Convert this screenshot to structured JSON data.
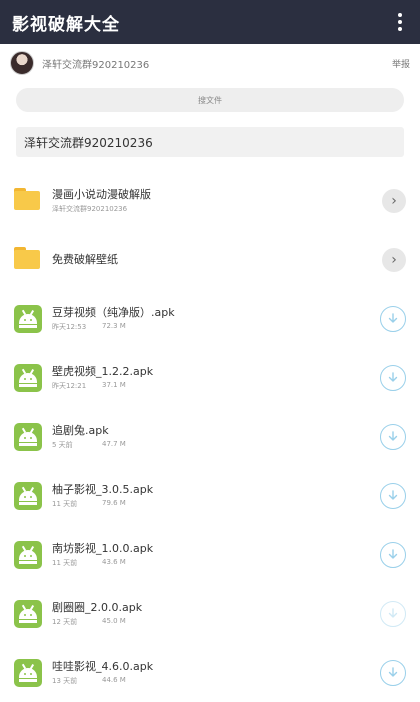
{
  "header": {
    "title": "影视破解大全"
  },
  "user": {
    "name": "泽轩交流群920210236",
    "report": "举报"
  },
  "search": {
    "label": "搜文件"
  },
  "notice": {
    "text": "泽轩交流群920210236"
  },
  "colors": {
    "appbar": "#2b2f40",
    "folder": "#f8c949",
    "apk": "#8bc34a",
    "download": "#9ad0ea"
  },
  "folders": [
    {
      "name": "漫画小说动漫破解版",
      "sub": "泽轩交流群920210236",
      "icon": "folder-icon",
      "action_icon": "chevron-right-icon"
    },
    {
      "name": "免费破解壁纸",
      "sub": "",
      "icon": "folder-icon",
      "action_icon": "chevron-right-icon"
    }
  ],
  "files": [
    {
      "name": "豆芽视频（纯净版）.apk",
      "time": "昨天12:53",
      "size": "72.3 M",
      "icon": "android-icon",
      "action_icon": "download-icon"
    },
    {
      "name": "壁虎视频_1.2.2.apk",
      "time": "昨天12:21",
      "size": "37.1 M",
      "icon": "android-icon",
      "action_icon": "download-icon"
    },
    {
      "name": "追剧兔.apk",
      "time": "5 天前",
      "size": "47.7 M",
      "icon": "android-icon",
      "action_icon": "download-icon"
    },
    {
      "name": "柚子影视_3.0.5.apk",
      "time": "11 天前",
      "size": "79.6 M",
      "icon": "android-icon",
      "action_icon": "download-icon"
    },
    {
      "name": "南坊影视_1.0.0.apk",
      "time": "11 天前",
      "size": "43.6 M",
      "icon": "android-icon",
      "action_icon": "download-icon"
    },
    {
      "name": "剧圈圈_2.0.0.apk",
      "time": "12 天前",
      "size": "45.0 M",
      "icon": "android-icon",
      "action_icon": "download-icon"
    },
    {
      "name": "哇哇影视_4.6.0.apk",
      "time": "13 天前",
      "size": "44.6 M",
      "icon": "android-icon",
      "action_icon": "download-icon"
    }
  ]
}
